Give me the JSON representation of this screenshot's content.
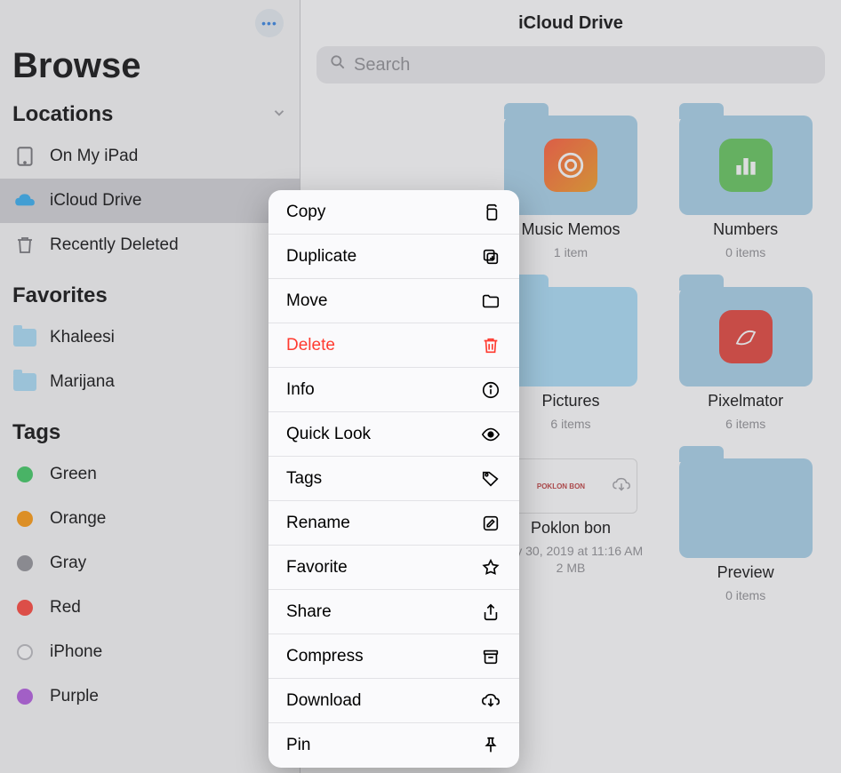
{
  "sidebar": {
    "title": "Browse",
    "sections": {
      "locations": {
        "header": "Locations",
        "items": [
          {
            "label": "On My iPad",
            "icon": "ipad-icon",
            "selected": false
          },
          {
            "label": "iCloud Drive",
            "icon": "cloud-icon",
            "selected": true
          },
          {
            "label": "Recently Deleted",
            "icon": "trash-icon",
            "selected": false
          }
        ]
      },
      "favorites": {
        "header": "Favorites",
        "items": [
          {
            "label": "Khaleesi",
            "color": "#a5dcf7"
          },
          {
            "label": "Marijana",
            "color": "#a5dcf7"
          }
        ]
      },
      "tags": {
        "header": "Tags",
        "items": [
          {
            "label": "Green",
            "color": "#34c759"
          },
          {
            "label": "Orange",
            "color": "#ff9500"
          },
          {
            "label": "Gray",
            "color": "#8e8e93"
          },
          {
            "label": "Red",
            "color": "#ff3b30"
          },
          {
            "label": "iPhone",
            "color": "outline"
          },
          {
            "label": "Purple",
            "color": "#af52de"
          }
        ]
      }
    }
  },
  "header": {
    "title": "iCloud Drive"
  },
  "search": {
    "placeholder": "Search"
  },
  "grid": {
    "items": [
      {
        "name": "",
        "meta": "",
        "type": "folder",
        "badge": null,
        "hidden": true
      },
      {
        "name": "Music Memos",
        "meta": "1 item",
        "type": "folder",
        "badge": "music-memos"
      },
      {
        "name": "Numbers",
        "meta": "0 items",
        "type": "folder",
        "badge": "numbers"
      },
      {
        "name": "",
        "meta": "",
        "type": "folder",
        "hidden": true
      },
      {
        "name": "Pictures",
        "meta": "6 items",
        "type": "folder-light",
        "badge": null,
        "selected": true
      },
      {
        "name": "Pixelmator",
        "meta": "6 items",
        "type": "folder",
        "badge": "pixelmator"
      },
      {
        "name": "",
        "meta": "",
        "type": "folder",
        "hidden": true
      },
      {
        "name": "Poklon bon",
        "meta": "May 30, 2019 at 11:16 AM\n2 MB",
        "type": "file",
        "thumb_text": "POKLON BON"
      },
      {
        "name": "Preview",
        "meta": "0 items",
        "type": "folder",
        "badge": null
      }
    ]
  },
  "context_menu": {
    "items": [
      {
        "label": "Copy",
        "icon": "copy-icon",
        "danger": false
      },
      {
        "label": "Duplicate",
        "icon": "duplicate-icon",
        "danger": false
      },
      {
        "label": "Move",
        "icon": "folder-icon",
        "danger": false
      },
      {
        "label": "Delete",
        "icon": "trash-icon",
        "danger": true
      },
      {
        "label": "Info",
        "icon": "info-icon",
        "danger": false
      },
      {
        "label": "Quick Look",
        "icon": "eye-icon",
        "danger": false
      },
      {
        "label": "Tags",
        "icon": "tag-icon",
        "danger": false
      },
      {
        "label": "Rename",
        "icon": "pencil-icon",
        "danger": false
      },
      {
        "label": "Favorite",
        "icon": "star-icon",
        "danger": false
      },
      {
        "label": "Share",
        "icon": "share-icon",
        "danger": false
      },
      {
        "label": "Compress",
        "icon": "archive-icon",
        "danger": false
      },
      {
        "label": "Download",
        "icon": "download-icon",
        "danger": false
      },
      {
        "label": "Pin",
        "icon": "pin-icon",
        "danger": false
      }
    ]
  },
  "colors": {
    "accent": "#007aff",
    "danger": "#ff3b30",
    "folder": "#a2cfe8",
    "folder_selected": "#a5dcf7"
  }
}
